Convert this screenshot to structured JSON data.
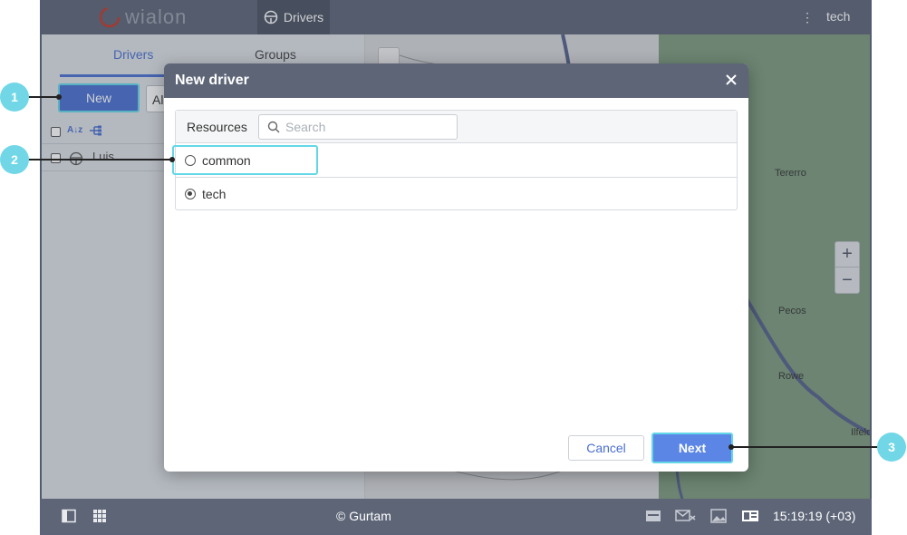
{
  "header": {
    "logo_text": "wialon",
    "active_tab": "Drivers",
    "user": "tech"
  },
  "sidebar": {
    "tabs": [
      "Drivers",
      "Groups"
    ],
    "new_button": "New",
    "filter_partial": "All",
    "drivers": [
      {
        "name": "Luis"
      }
    ]
  },
  "map": {
    "labels": [
      "Tererro",
      "Pecos",
      "Rowe",
      "Ilfeld"
    ],
    "zoom_in": "+",
    "zoom_out": "−"
  },
  "footer": {
    "copyright": "© Gurtam",
    "clock": "15:19:19 (+03)"
  },
  "dialog": {
    "title": "New driver",
    "resources_label": "Resources",
    "search_placeholder": "Search",
    "resources": [
      {
        "name": "common",
        "selected": false
      },
      {
        "name": "tech",
        "selected": true
      }
    ],
    "cancel_label": "Cancel",
    "next_label": "Next"
  },
  "callouts": [
    "1",
    "2",
    "3"
  ],
  "colors": {
    "accent": "#4a6fd0",
    "highlight": "#63d7e8",
    "header": "#5d6577"
  }
}
